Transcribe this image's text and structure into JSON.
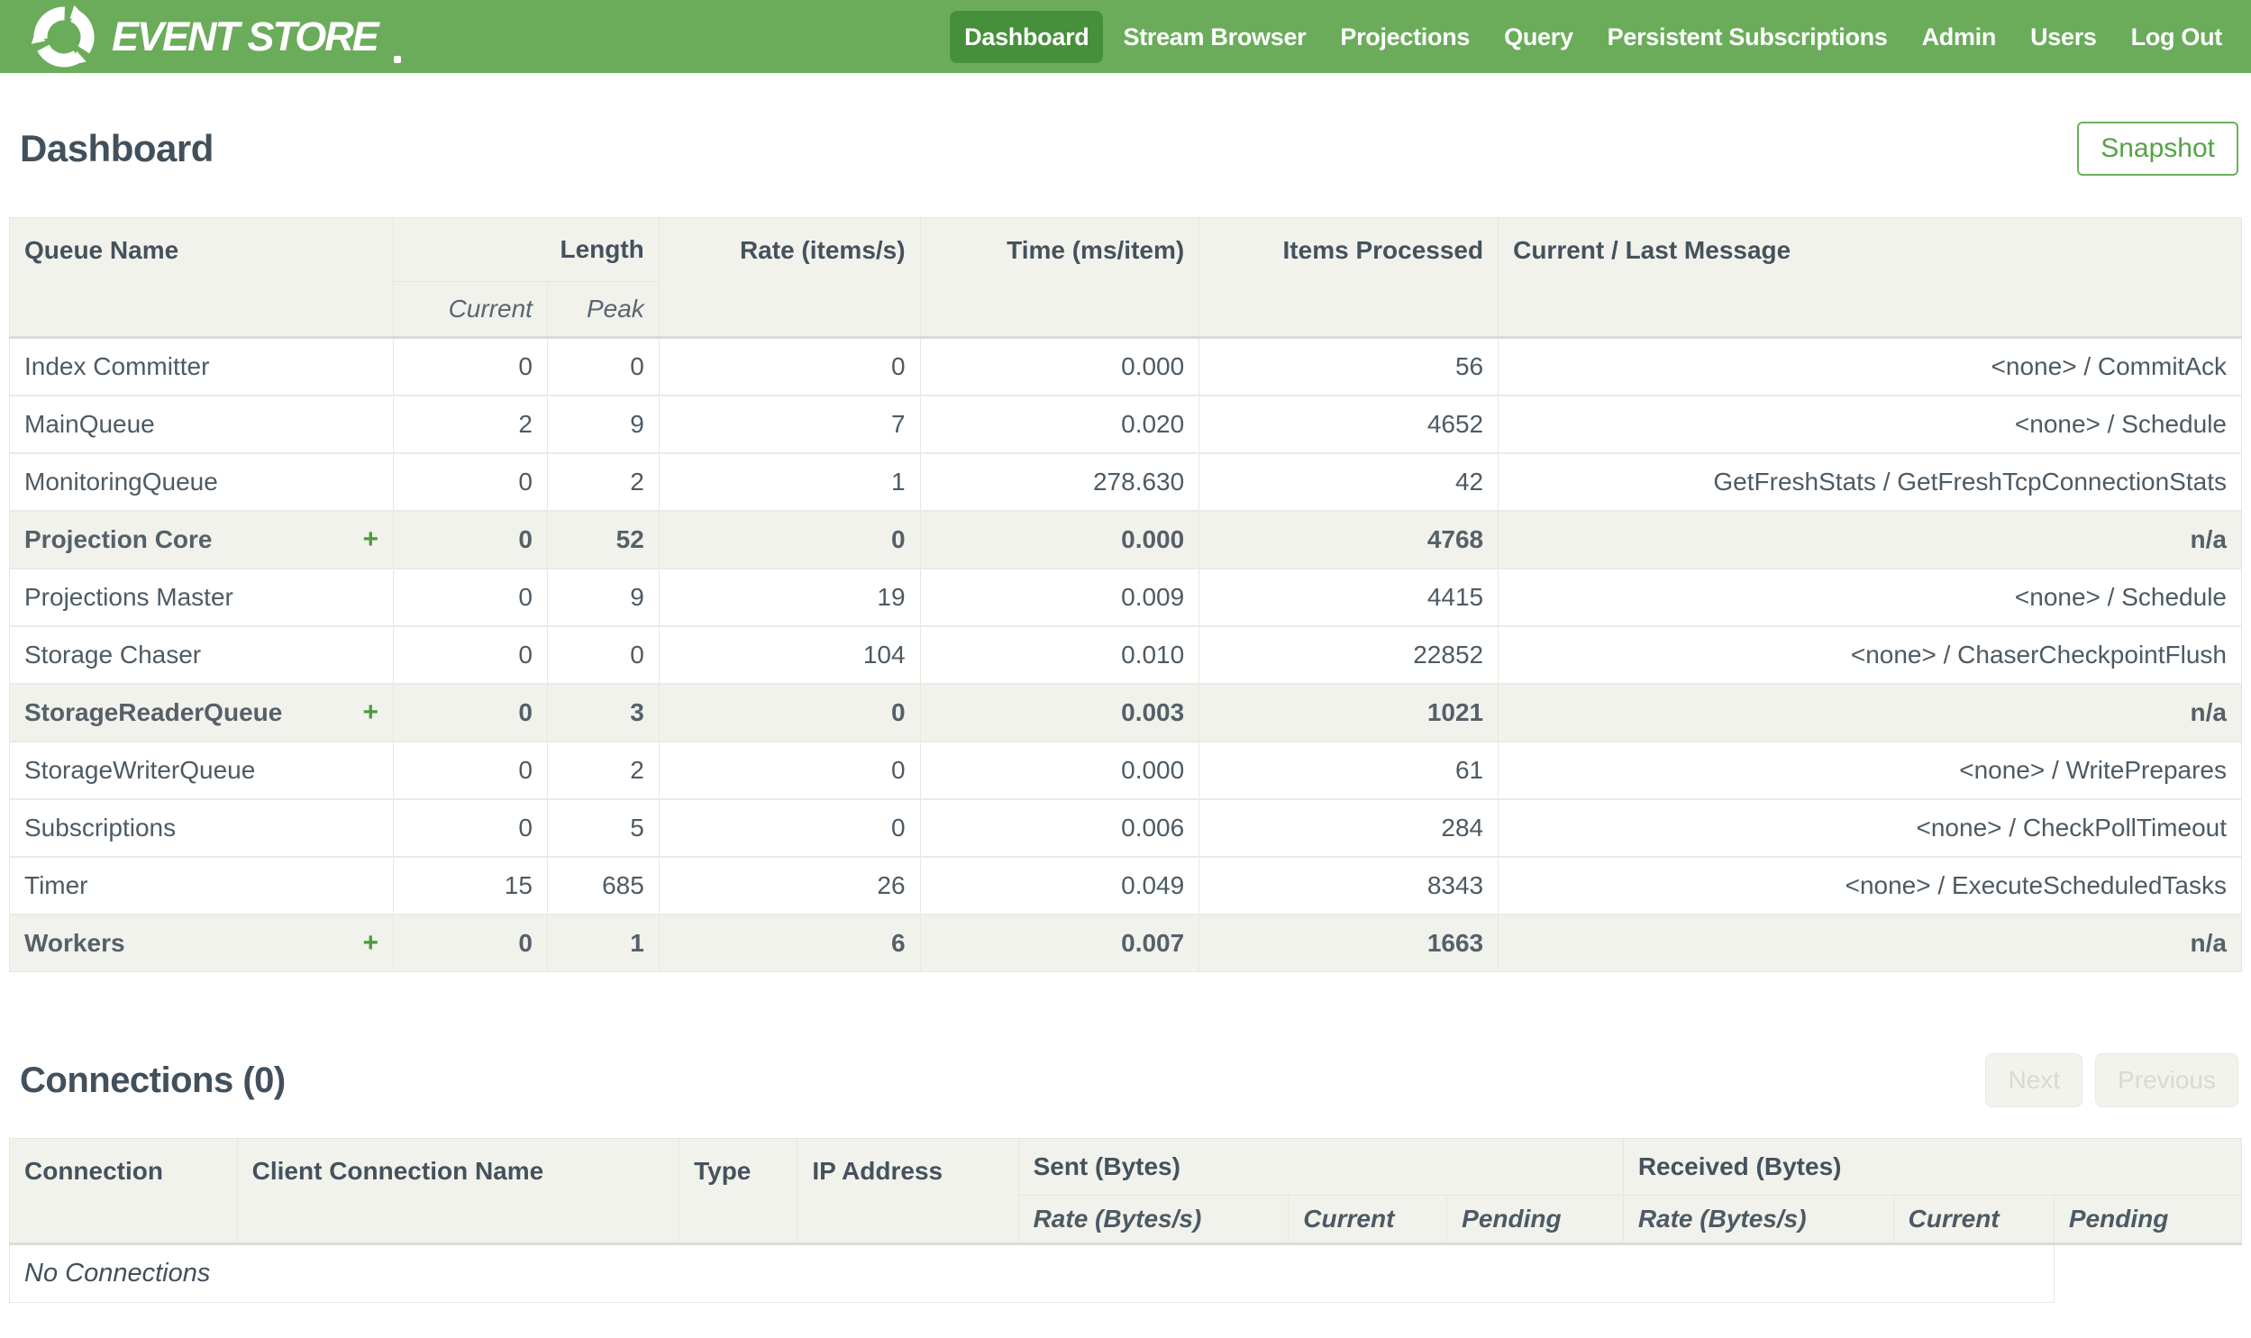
{
  "nav": {
    "brand": "EVENT STORE",
    "items": [
      {
        "label": "Dashboard",
        "active": true
      },
      {
        "label": "Stream Browser",
        "active": false
      },
      {
        "label": "Projections",
        "active": false
      },
      {
        "label": "Query",
        "active": false
      },
      {
        "label": "Persistent Subscriptions",
        "active": false
      },
      {
        "label": "Admin",
        "active": false
      },
      {
        "label": "Users",
        "active": false
      },
      {
        "label": "Log Out",
        "active": false
      }
    ]
  },
  "page": {
    "title": "Dashboard",
    "snapshot_button": "Snapshot"
  },
  "colors": {
    "nav_background": "#6BAC5B",
    "nav_active_background": "#47903B",
    "accent_green": "#55A347",
    "heading_text": "#42505C",
    "table_header_background": "#F1F2EC"
  },
  "queue_table": {
    "headers": {
      "queue_name": "Queue Name",
      "length": "Length",
      "current": "Current",
      "peak": "Peak",
      "rate": "Rate (items/s)",
      "time": "Time (ms/item)",
      "items_processed": "Items Processed",
      "message": "Current / Last Message"
    },
    "expander": "+",
    "rows": [
      {
        "name": "Index Committer",
        "group": false,
        "current": "0",
        "peak": "0",
        "rate": "0",
        "time": "0.000",
        "items": "56",
        "message": "<none> / CommitAck"
      },
      {
        "name": "MainQueue",
        "group": false,
        "current": "2",
        "peak": "9",
        "rate": "7",
        "time": "0.020",
        "items": "4652",
        "message": "<none> / Schedule"
      },
      {
        "name": "MonitoringQueue",
        "group": false,
        "current": "0",
        "peak": "2",
        "rate": "1",
        "time": "278.630",
        "items": "42",
        "message": "GetFreshStats / GetFreshTcpConnectionStats"
      },
      {
        "name": "Projection Core",
        "group": true,
        "current": "0",
        "peak": "52",
        "rate": "0",
        "time": "0.000",
        "items": "4768",
        "message": "n/a"
      },
      {
        "name": "Projections Master",
        "group": false,
        "current": "0",
        "peak": "9",
        "rate": "19",
        "time": "0.009",
        "items": "4415",
        "message": "<none> / Schedule"
      },
      {
        "name": "Storage Chaser",
        "group": false,
        "current": "0",
        "peak": "0",
        "rate": "104",
        "time": "0.010",
        "items": "22852",
        "message": "<none> / ChaserCheckpointFlush"
      },
      {
        "name": "StorageReaderQueue",
        "group": true,
        "current": "0",
        "peak": "3",
        "rate": "0",
        "time": "0.003",
        "items": "1021",
        "message": "n/a"
      },
      {
        "name": "StorageWriterQueue",
        "group": false,
        "current": "0",
        "peak": "2",
        "rate": "0",
        "time": "0.000",
        "items": "61",
        "message": "<none> / WritePrepares"
      },
      {
        "name": "Subscriptions",
        "group": false,
        "current": "0",
        "peak": "5",
        "rate": "0",
        "time": "0.006",
        "items": "284",
        "message": "<none> / CheckPollTimeout"
      },
      {
        "name": "Timer",
        "group": false,
        "current": "15",
        "peak": "685",
        "rate": "26",
        "time": "0.049",
        "items": "8343",
        "message": "<none> / ExecuteScheduledTasks"
      },
      {
        "name": "Workers",
        "group": true,
        "current": "0",
        "peak": "1",
        "rate": "6",
        "time": "0.007",
        "items": "1663",
        "message": "n/a"
      }
    ]
  },
  "connections": {
    "title": "Connections (0)",
    "next_button": "Next",
    "previous_button": "Previous",
    "headers": {
      "connection": "Connection",
      "client_connection_name": "Client Connection Name",
      "type": "Type",
      "ip_address": "IP Address",
      "sent": "Sent (Bytes)",
      "received": "Received (Bytes)",
      "rate": "Rate (Bytes/s)",
      "current": "Current",
      "pending": "Pending"
    },
    "empty_message": "No Connections"
  }
}
